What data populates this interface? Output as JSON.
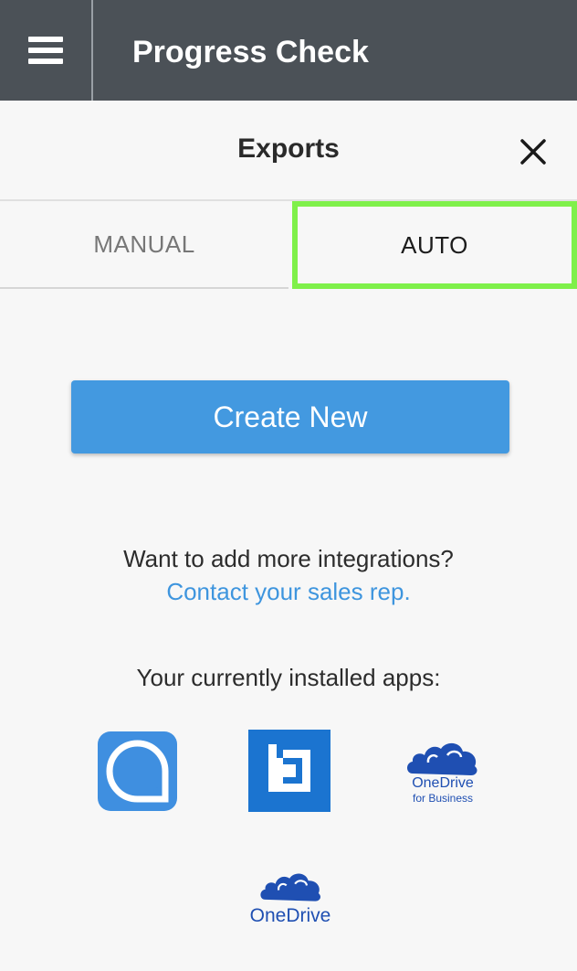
{
  "topbar": {
    "title": "Progress Check",
    "menu_icon": "hamburger-menu-icon"
  },
  "exports": {
    "title": "Exports",
    "close_icon": "close-icon",
    "tabs": [
      {
        "label": "MANUAL",
        "selected": false
      },
      {
        "label": "AUTO",
        "selected": true
      }
    ],
    "create_button": "Create New",
    "integrations_prompt": "Want to add more integrations?",
    "contact_link": "Contact your sales rep.",
    "installed_label": "Your currently installed apps:",
    "apps": [
      {
        "name": "quip",
        "icon": "quip-app-icon"
      },
      {
        "name": "box",
        "icon": "box-app-icon"
      },
      {
        "name": "onedrive-business",
        "icon": "onedrive-business-app-icon",
        "line1": "OneDrive",
        "line2": "for Business"
      },
      {
        "name": "onedrive",
        "icon": "onedrive-app-icon",
        "line1": "OneDrive"
      }
    ]
  },
  "colors": {
    "topbar_bg": "#4b5157",
    "primary": "#4399e0",
    "link": "#3e95de",
    "highlight": "#7ff04a",
    "onedrive_blue": "#1f4fb2"
  }
}
